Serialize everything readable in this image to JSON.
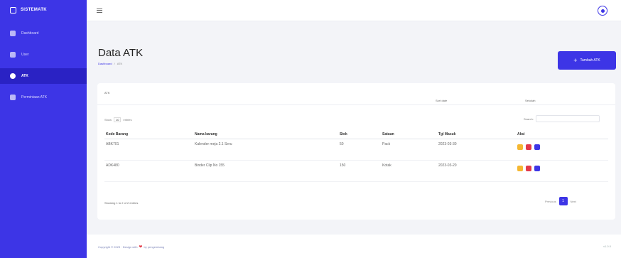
{
  "colors": {
    "accent": "#3d35e6",
    "warning": "#f5b731",
    "danger": "#e2394a",
    "info": "#3d35e6"
  },
  "sidebar": {
    "brand": "SISTEMATK",
    "brand_icon": "hat-icon",
    "items": [
      {
        "label": "Dashboard",
        "icon": "dashboard-icon",
        "active": false
      },
      {
        "label": "User",
        "icon": "user-icon",
        "active": false
      },
      {
        "label": "ATK",
        "icon": "box-icon",
        "active": true
      },
      {
        "label": "Permintaan ATK",
        "icon": "document-icon",
        "active": false
      }
    ]
  },
  "topbar": {
    "menu_icon": "hamburger-icon",
    "avatar_icon": "user-circle-icon"
  },
  "page": {
    "title": "Data ATK",
    "breadcrumb": [
      "Dashboard",
      "ATK"
    ],
    "add_button": "Tambah ATK"
  },
  "card": {
    "header_title": "ATK",
    "header_mid": "Sort date",
    "header_right": "Sekolah",
    "length_prefix": "Show",
    "length_value": "10",
    "length_suffix": "entries",
    "search_label": "Search:",
    "columns": [
      "Kode Barang",
      "Nama barang",
      "Stok",
      "Satuan",
      "Tgl Masuk",
      "Aksi"
    ],
    "rows": [
      {
        "kode": "ABK701",
        "nama": "Kalender meja 2.1 Seru",
        "stok": "50",
        "satuan": "Pack",
        "tgl": "2023-03-30"
      },
      {
        "kode": "ADK480",
        "nama": "Binder Clip No 155",
        "stok": "150",
        "satuan": "Kotak",
        "tgl": "2023-03-20"
      }
    ],
    "info": "Showing 1 to 2 of 2 entries",
    "pagination": {
      "prev": "Previous",
      "current": "1",
      "next": "Next"
    }
  },
  "footer": {
    "left_text": "Copyright © 2023 · Design with",
    "left_heart": "❤",
    "left_author": "by pengembang",
    "right_text": "v1.0.0"
  }
}
